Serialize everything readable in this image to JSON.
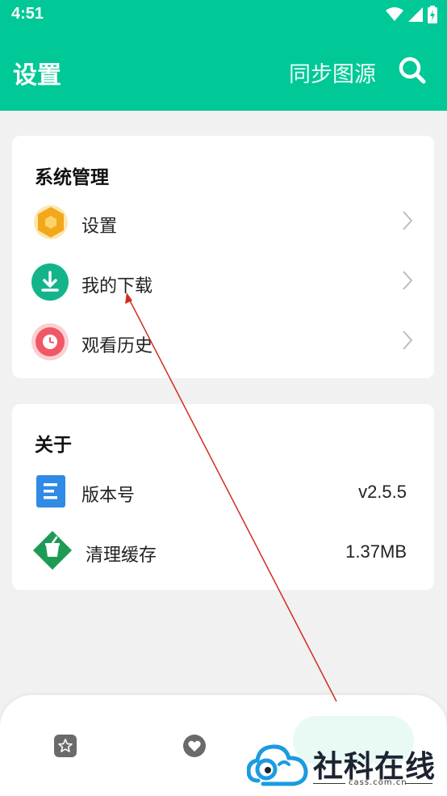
{
  "status_bar": {
    "time": "4:51"
  },
  "app_bar": {
    "title": "设置",
    "sync_label": "同步图源"
  },
  "system_card": {
    "title": "系统管理",
    "items": [
      {
        "label": "设置"
      },
      {
        "label": "我的下载"
      },
      {
        "label": "观看历史"
      }
    ]
  },
  "about_card": {
    "title": "关于",
    "items": [
      {
        "label": "版本号",
        "value": "v2.5.5"
      },
      {
        "label": "清理缓存",
        "value": "1.37MB"
      }
    ]
  },
  "watermark": {
    "text": "社科在线",
    "url": "cass.com.cn"
  },
  "colors": {
    "brand": "#00c896",
    "annotation_arrow": "#d32b1e"
  }
}
